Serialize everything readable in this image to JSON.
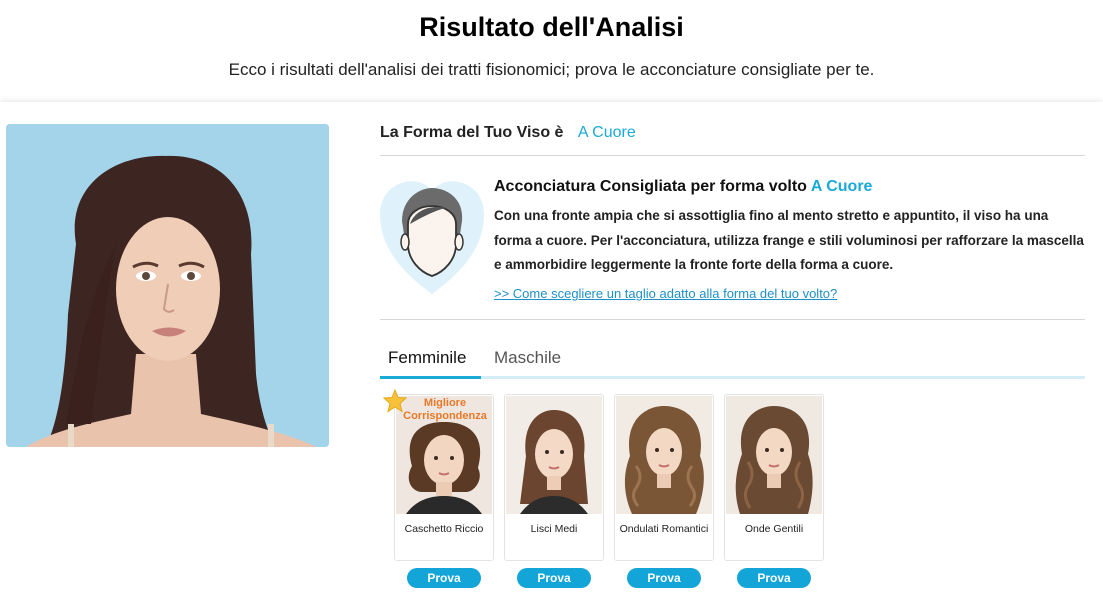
{
  "header": {
    "title": "Risultato dell'Analisi",
    "subtitle": "Ecco i risultati dell'analisi dei tratti fisionomici; prova le acconciature consigliate per te."
  },
  "face_shape": {
    "label": "La Forma del Tuo Viso è",
    "value": "A Cuore"
  },
  "recommendation": {
    "title_prefix": "Acconciatura Consigliata per forma volto",
    "title_accent": "A Cuore",
    "body": "Con una fronte ampia che si assottiglia fino al mento stretto e appuntito, il viso ha una forma a cuore. Per l'acconciatura, utilizza frange e stili voluminosi per rafforzare la mascella e ammorbidire leggermente la fronte forte della forma a cuore.",
    "link": ">> Come scegliere un taglio adatto alla forma del tuo volto?"
  },
  "tabs": [
    {
      "label": "Femminile",
      "active": true
    },
    {
      "label": "Maschile",
      "active": false
    }
  ],
  "hairstyles": [
    {
      "name": "Caschetto Riccio",
      "badge": "Migliore Corrispondenza",
      "button": "Prova"
    },
    {
      "name": "Lisci Medi",
      "button": "Prova"
    },
    {
      "name": "Ondulati Romantici",
      "button": "Prova"
    },
    {
      "name": "Onde Gentili",
      "button": "Prova"
    }
  ],
  "colors": {
    "accent": "#1aaad6",
    "button": "#13a5d8",
    "badge": "#e8792a",
    "photo_bg": "#9fd3e8"
  }
}
